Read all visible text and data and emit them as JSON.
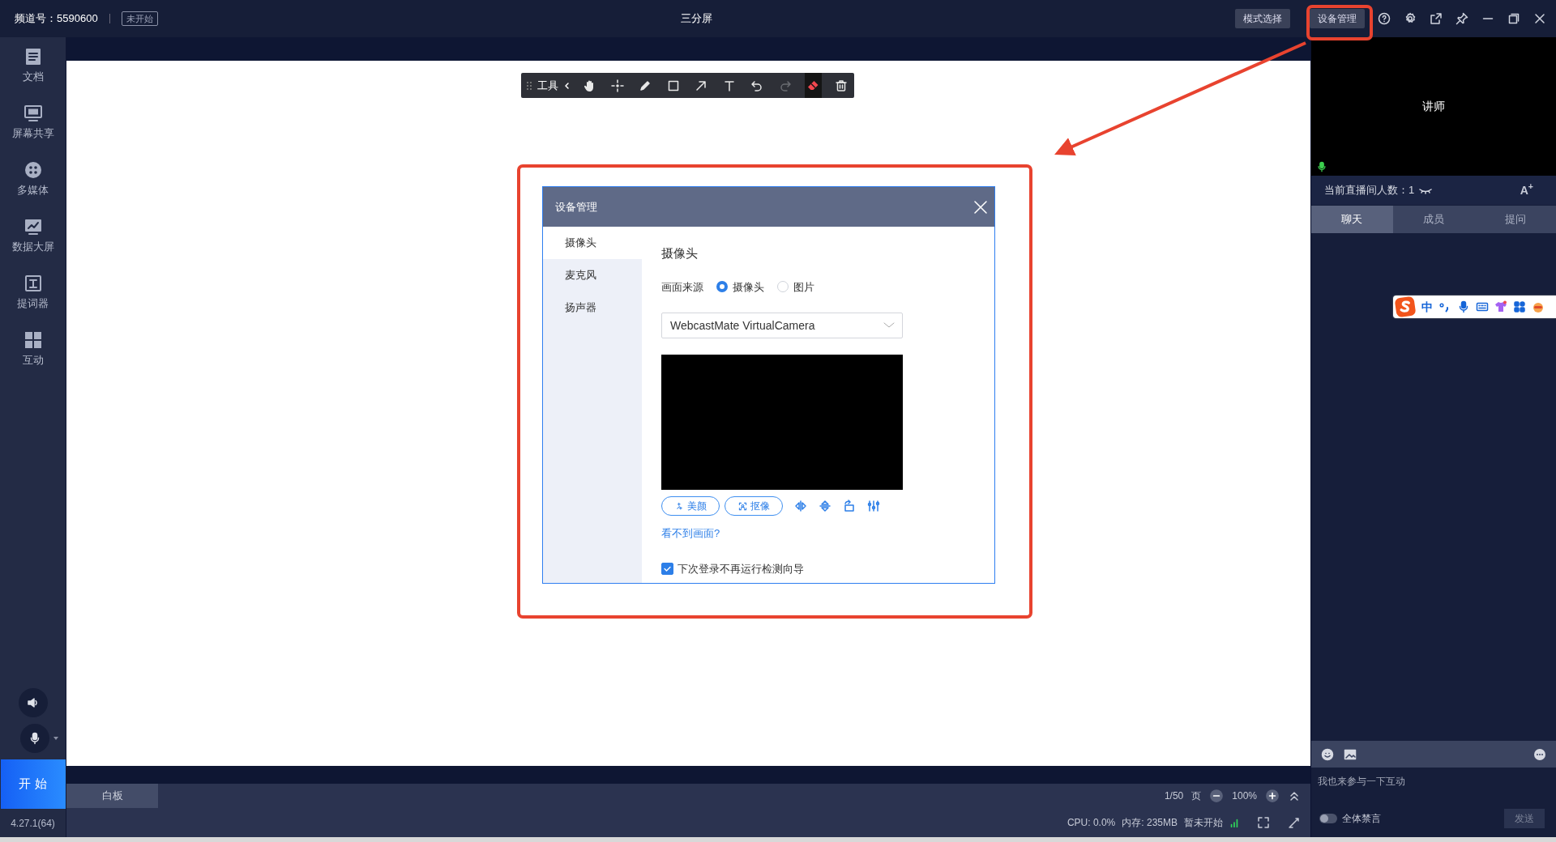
{
  "top_bar": {
    "channel": "频道号：5590600",
    "status_badge": "未开始",
    "title": "三分屏",
    "mode_button": "模式选择",
    "device_button": "设备管理"
  },
  "sidebar": {
    "items": [
      {
        "label": "文档",
        "kind": "doc"
      },
      {
        "label": "屏幕共享",
        "kind": "screen"
      },
      {
        "label": "多媒体",
        "kind": "media"
      },
      {
        "label": "数据大屏",
        "kind": "chart"
      },
      {
        "label": "提词器",
        "kind": "prompter"
      },
      {
        "label": "互动",
        "kind": "grid"
      }
    ],
    "start_button": "开 始",
    "version": "4.27.1(64)"
  },
  "toolbar": {
    "label": "工具",
    "tools": [
      {
        "kind": "hand",
        "selected": false,
        "disabled": false
      },
      {
        "kind": "pointer",
        "selected": false,
        "disabled": false
      },
      {
        "kind": "pen",
        "selected": false,
        "disabled": false
      },
      {
        "kind": "rect",
        "selected": false,
        "disabled": false
      },
      {
        "kind": "arrow",
        "selected": false,
        "disabled": false
      },
      {
        "kind": "text",
        "selected": false,
        "disabled": false
      },
      {
        "kind": "undo",
        "selected": false,
        "disabled": false
      },
      {
        "kind": "redo",
        "selected": false,
        "disabled": true
      },
      {
        "kind": "eraser",
        "selected": true,
        "disabled": false
      },
      {
        "kind": "trash",
        "selected": false,
        "disabled": false
      }
    ]
  },
  "dialog": {
    "title": "设备管理",
    "nav": [
      {
        "label": "摄像头",
        "selected": true
      },
      {
        "label": "麦克风",
        "selected": false
      },
      {
        "label": "扬声器",
        "selected": false
      }
    ],
    "heading": "摄像头",
    "source_label": "画面来源",
    "sources": [
      {
        "label": "摄像头",
        "selected": true
      },
      {
        "label": "图片",
        "selected": false
      }
    ],
    "camera": "WebcastMate VirtualCamera",
    "effect_buttons": [
      {
        "label": "美颜",
        "kind": "beauty"
      },
      {
        "label": "抠像",
        "kind": "matting"
      }
    ],
    "help_link": "看不到画面?",
    "skip_wizard": {
      "label": "下次登录不再运行检测向导",
      "checked": true
    }
  },
  "right_panel": {
    "video_label": "讲师",
    "viewer_count": "当前直播间人数：1",
    "font_button": "A$^{+}$",
    "tabs": [
      {
        "label": "聊天",
        "selected": true
      },
      {
        "label": "成员",
        "selected": false
      },
      {
        "label": "提问",
        "selected": false
      }
    ],
    "input_placeholder": "我也来参与一下互动",
    "mute_all": {
      "label": "全体禁言",
      "on": false
    },
    "send_button": "发送"
  },
  "ime_bar": {
    "mode": "中"
  },
  "bottom_bar": {
    "tabs": [
      {
        "label": "白板",
        "selected": true
      }
    ],
    "page": "1/50",
    "page_unit": "页",
    "zoom": "100%",
    "cpu": "CPU: 0.0%",
    "memory": "内存: 235MB",
    "stream_status": "暂未开始"
  }
}
